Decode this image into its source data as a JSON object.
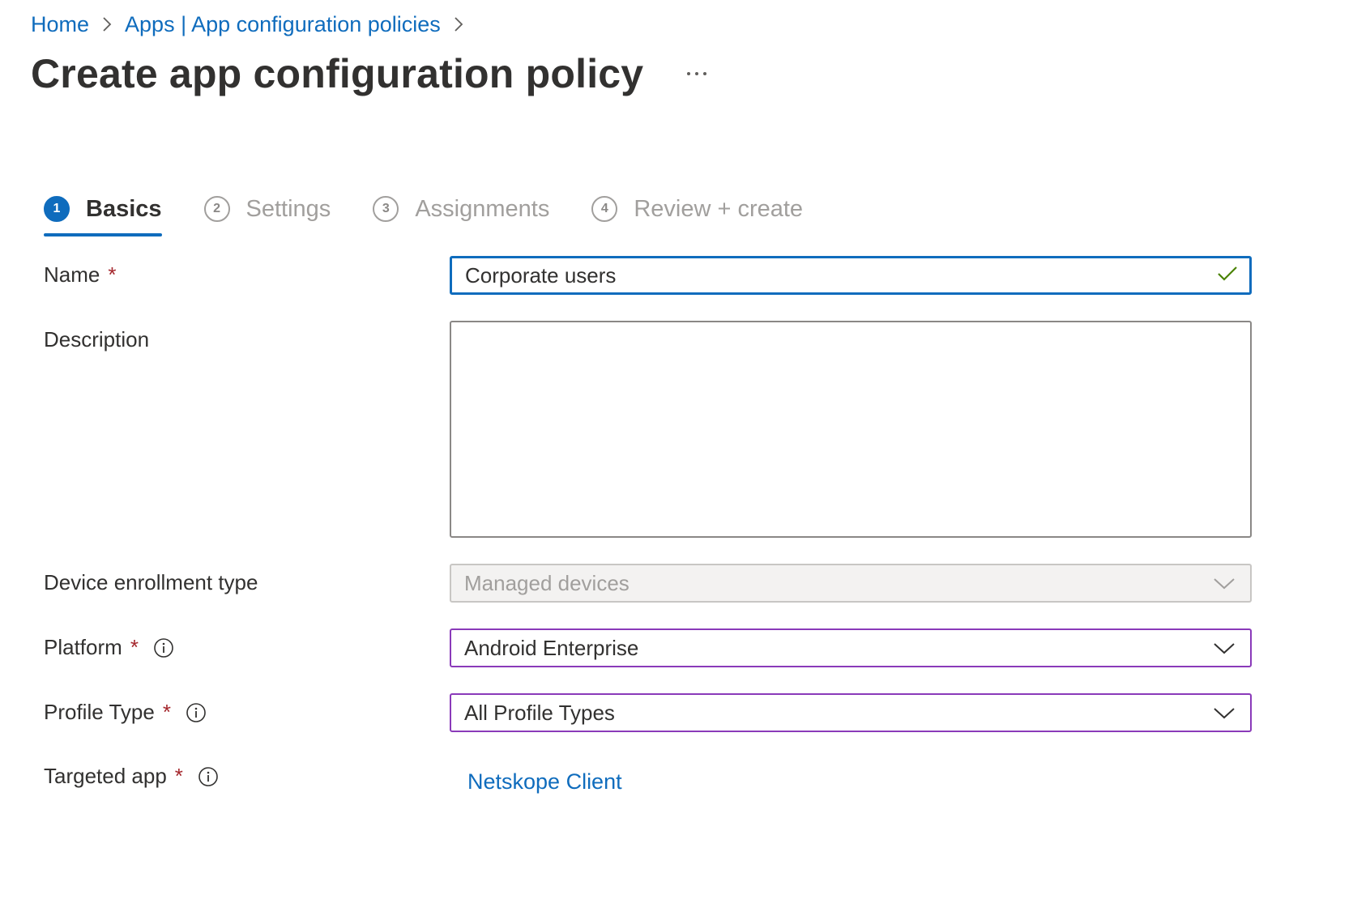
{
  "breadcrumb": {
    "items": [
      "Home",
      "Apps | App configuration policies"
    ]
  },
  "header": {
    "title": "Create app configuration policy",
    "more_label": "..."
  },
  "tabs": [
    {
      "number": "1",
      "label": "Basics",
      "active": true
    },
    {
      "number": "2",
      "label": "Settings",
      "active": false
    },
    {
      "number": "3",
      "label": "Assignments",
      "active": false
    },
    {
      "number": "4",
      "label": "Review + create",
      "active": false
    }
  ],
  "form": {
    "required_mark": "*",
    "name": {
      "label": "Name",
      "value": "Corporate users",
      "valid": true
    },
    "description": {
      "label": "Description",
      "value": ""
    },
    "enrollment": {
      "label": "Device enrollment type",
      "value": "Managed devices",
      "disabled": true
    },
    "platform": {
      "label": "Platform",
      "value": "Android Enterprise"
    },
    "profile_type": {
      "label": "Profile Type",
      "value": "All Profile Types"
    },
    "targeted_app": {
      "label": "Targeted app",
      "value": "Netskope Client"
    }
  },
  "colors": {
    "link": "#0f6cbd",
    "required": "#a4262c",
    "dropdown_border": "#8a3ab9",
    "valid_check": "#498205"
  },
  "icons": {
    "breadcrumb_separator": "chevron-right-icon",
    "info": "info-icon",
    "dropdown": "chevron-down-icon",
    "valid": "checkmark-icon"
  }
}
